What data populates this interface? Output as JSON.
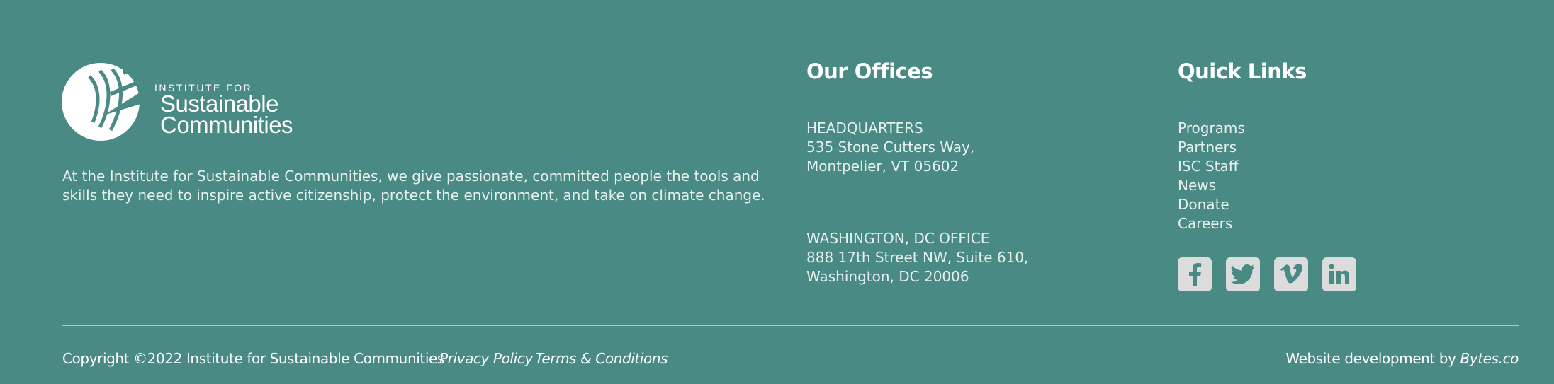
{
  "logo": {
    "small_text": "INSTITUTE FOR",
    "line1": "Sustainable",
    "line2": "Communities"
  },
  "about": "At the Institute for Sustainable Communities, we give passionate, committed people the tools and skills they need to inspire active citizenship, protect the environment, and take on climate change.",
  "offices": {
    "heading": "Our Offices",
    "hq": {
      "name": "HEADQUARTERS",
      "line1": "535 Stone Cutters Way,",
      "line2": "Montpelier, VT 05602"
    },
    "dc": {
      "name": "WASHINGTON, DC OFFICE",
      "line1": "888 17th Street NW, Suite 610,",
      "line2": "Washington, DC 20006"
    }
  },
  "quick_links": {
    "heading": "Quick Links",
    "items": [
      "Programs",
      "Partners",
      "ISC Staff",
      "News",
      "Donate",
      "Careers"
    ]
  },
  "social": {
    "icons": [
      "facebook-icon",
      "twitter-icon",
      "vimeo-icon",
      "linkedin-icon"
    ],
    "icon_bg": "#dcdcdc",
    "icon_fg": "#4a8a84"
  },
  "bottom": {
    "copyright": "Copyright ©2022 Institute for Sustainable Communities",
    "privacy": "Privacy Policy",
    "terms": "Terms & Conditions",
    "credit_prefix": "Website development by ",
    "credit_link": "Bytes.co"
  },
  "colors": {
    "background": "#4a8a84",
    "divider": "#a9ccc8",
    "text": "#ffffff"
  }
}
